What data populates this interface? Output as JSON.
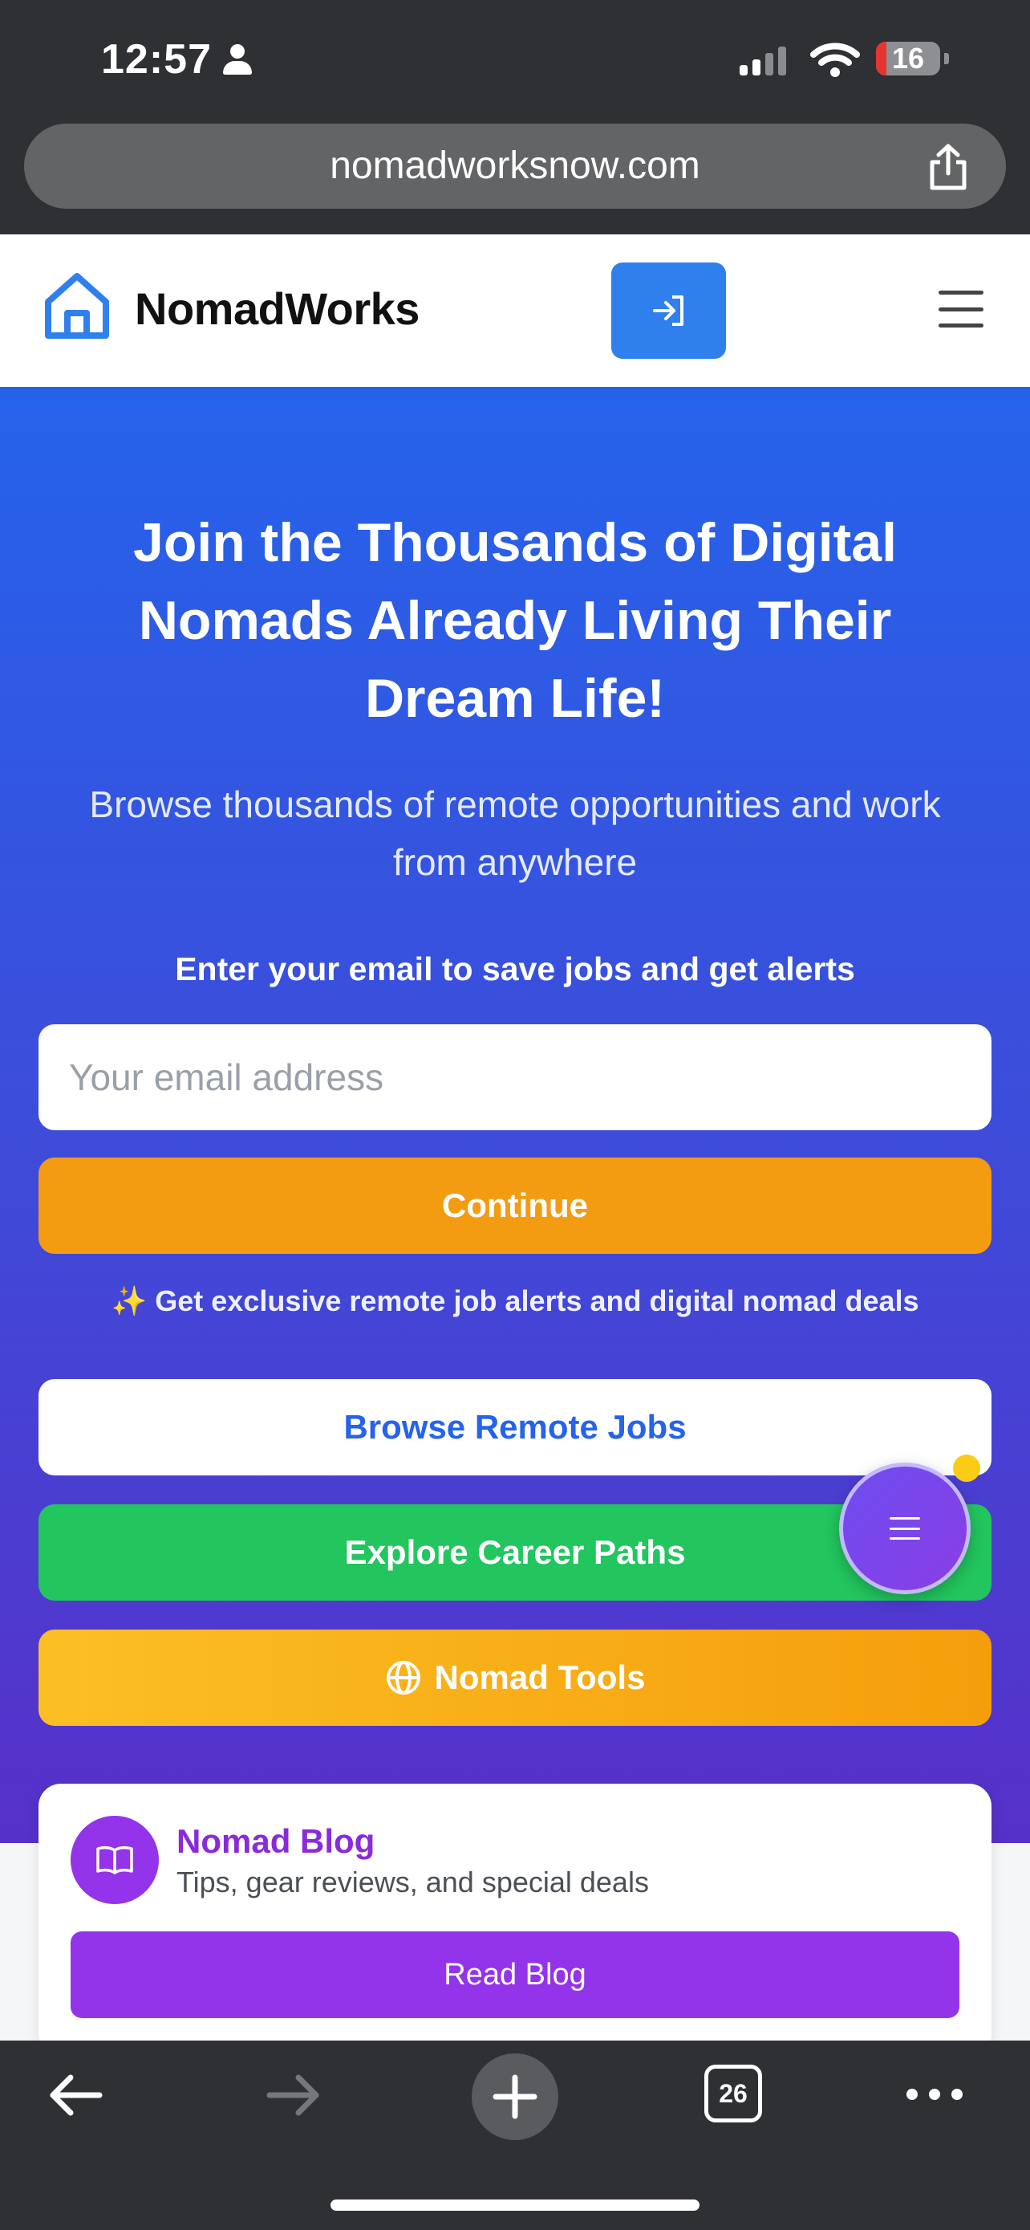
{
  "status_bar": {
    "time": "12:57",
    "battery": "16",
    "battery_level": 0.16
  },
  "browser": {
    "url": "nomadworksnow.com",
    "tab_count": "26"
  },
  "header": {
    "brand": "NomadWorks"
  },
  "hero": {
    "title": "Join the Thousands of Digital Nomads Already Living Their Dream Life!",
    "subtitle": "Browse thousands of remote opportunities and work from anywhere",
    "email_prompt": "Enter your email to save jobs and get alerts",
    "email_placeholder": "Your email address",
    "continue_label": "Continue",
    "alerts_note": "Get exclusive remote job alerts and digital nomad deals",
    "browse_label": "Browse Remote Jobs",
    "career_label": "Explore Career Paths",
    "tools_label": "Nomad Tools"
  },
  "blog": {
    "title": "Nomad Blog",
    "description": "Tips, gear reviews, and special deals",
    "button_label": "Read Blog"
  },
  "colors": {
    "primary_blue": "#2563eb",
    "continue_orange": "#f39c12",
    "career_green": "#22c55e",
    "blog_purple": "#9333ea",
    "fab_purple": "#7c3aed"
  }
}
